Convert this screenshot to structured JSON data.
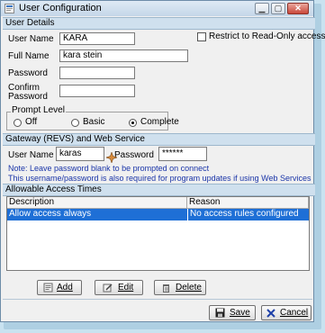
{
  "window": {
    "title": "User Configuration"
  },
  "sections": {
    "user_details": "User Details",
    "gateway": "Gateway (REVS) and Web Service",
    "access_times": "Allowable Access Times"
  },
  "user_details": {
    "user_name_label": "User Name",
    "user_name_value": "KARA",
    "full_name_label": "Full Name",
    "full_name_value": "kara stein",
    "password_label": "Password",
    "password_value": "",
    "confirm_label_1": "Confirm",
    "confirm_label_2": "Password",
    "confirm_value": "",
    "restrict_label": "Restrict to Read-Only access",
    "restrict_checked": false
  },
  "prompt_level": {
    "legend": "Prompt Level",
    "options": [
      "Off",
      "Basic",
      "Complete"
    ],
    "selected": "Complete"
  },
  "gateway": {
    "user_name_label": "User Name",
    "user_name_value": "karas",
    "password_label": "Password",
    "password_value": "******",
    "note_1": "Note: Leave password blank to be prompted on connect",
    "note_2": "This username/password is also required for program updates if using Web Services"
  },
  "access_grid": {
    "columns": [
      "Description",
      "Reason"
    ],
    "rows": [
      {
        "description": "Allow access always",
        "reason": "No access rules configured",
        "selected": true
      }
    ]
  },
  "buttons": {
    "add": "Add",
    "edit": "Edit",
    "delete": "Delete",
    "save": "Save",
    "cancel": "Cancel"
  },
  "colors": {
    "section_header": "#cfe0ee",
    "selection": "#1e6fd6",
    "note_text": "#1a35a8"
  }
}
